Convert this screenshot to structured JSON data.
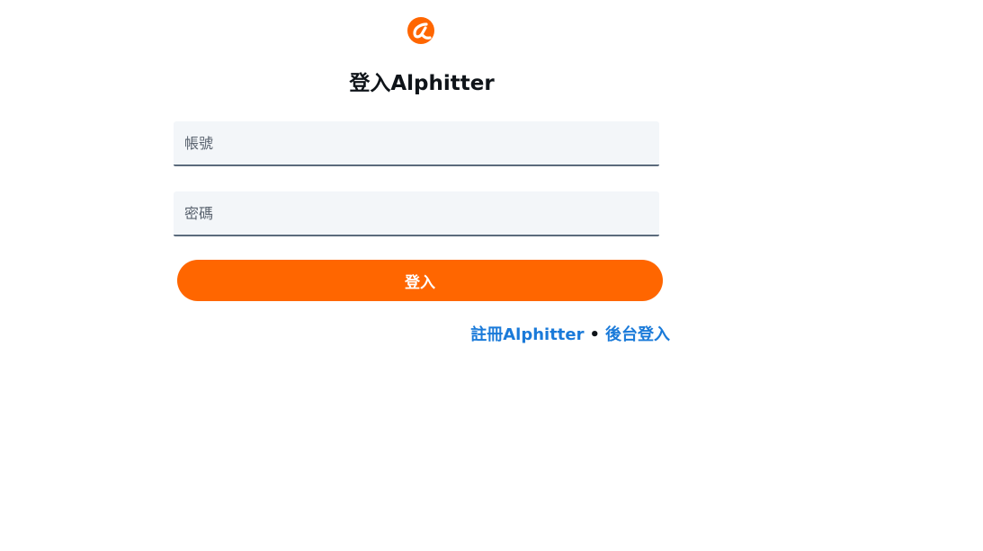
{
  "brand": {
    "logo_icon": "alphitter-logo-icon",
    "accent_color": "#ff6600"
  },
  "login": {
    "title": "登入Alphitter",
    "username_placeholder": "帳號",
    "password_placeholder": "密碼",
    "submit_label": "登入"
  },
  "links": {
    "register_label": "註冊Alphitter",
    "separator": "•",
    "admin_login_label": "後台登入"
  }
}
